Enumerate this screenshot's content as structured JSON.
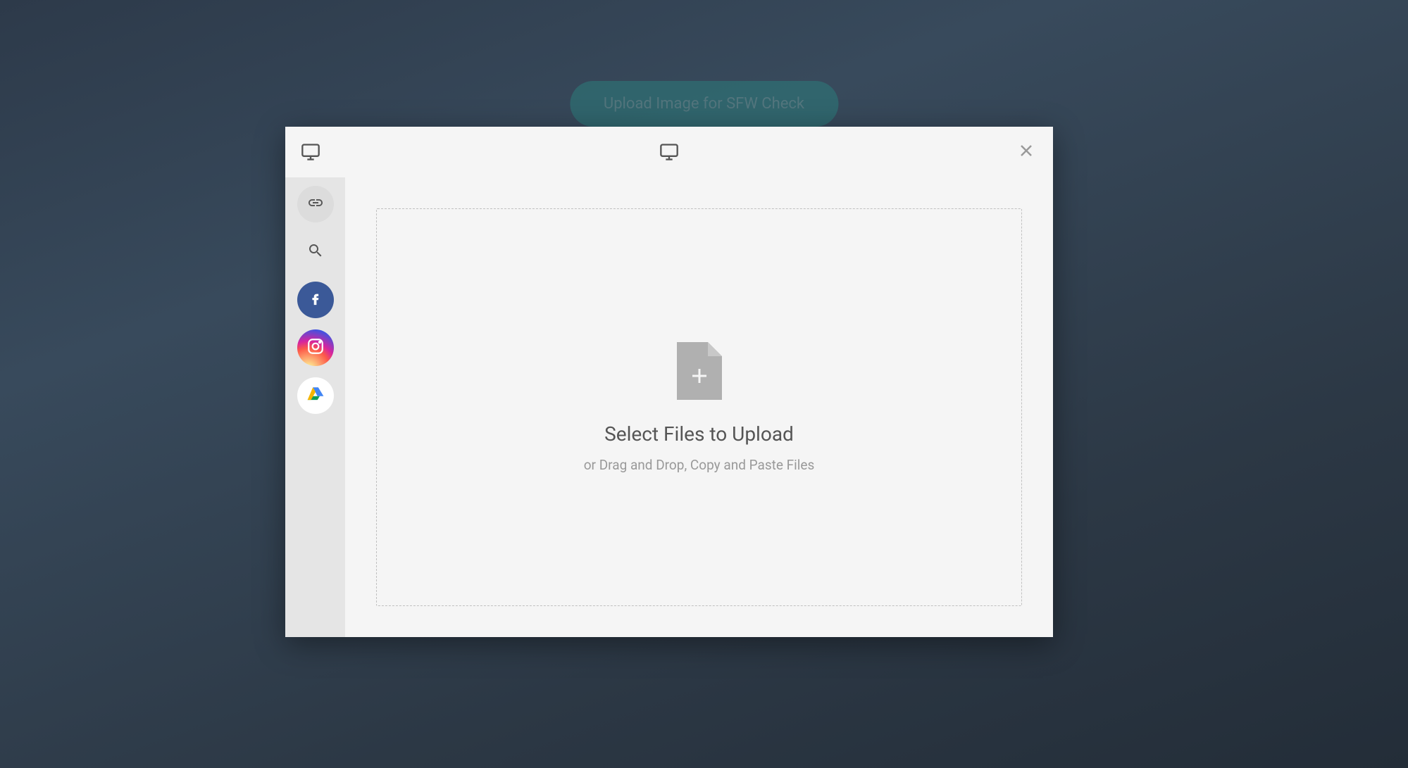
{
  "backdrop": {
    "button_label": "Upload Image for SFW Check"
  },
  "dialog": {
    "dropzone": {
      "title": "Select Files to Upload",
      "subtitle": "or Drag and Drop, Copy and Paste Files"
    },
    "sidebar": {
      "items": [
        {
          "name": "link",
          "label": "Link"
        },
        {
          "name": "search",
          "label": "Search"
        },
        {
          "name": "facebook",
          "label": "Facebook"
        },
        {
          "name": "instagram",
          "label": "Instagram"
        },
        {
          "name": "google-drive",
          "label": "Google Drive"
        }
      ]
    }
  }
}
